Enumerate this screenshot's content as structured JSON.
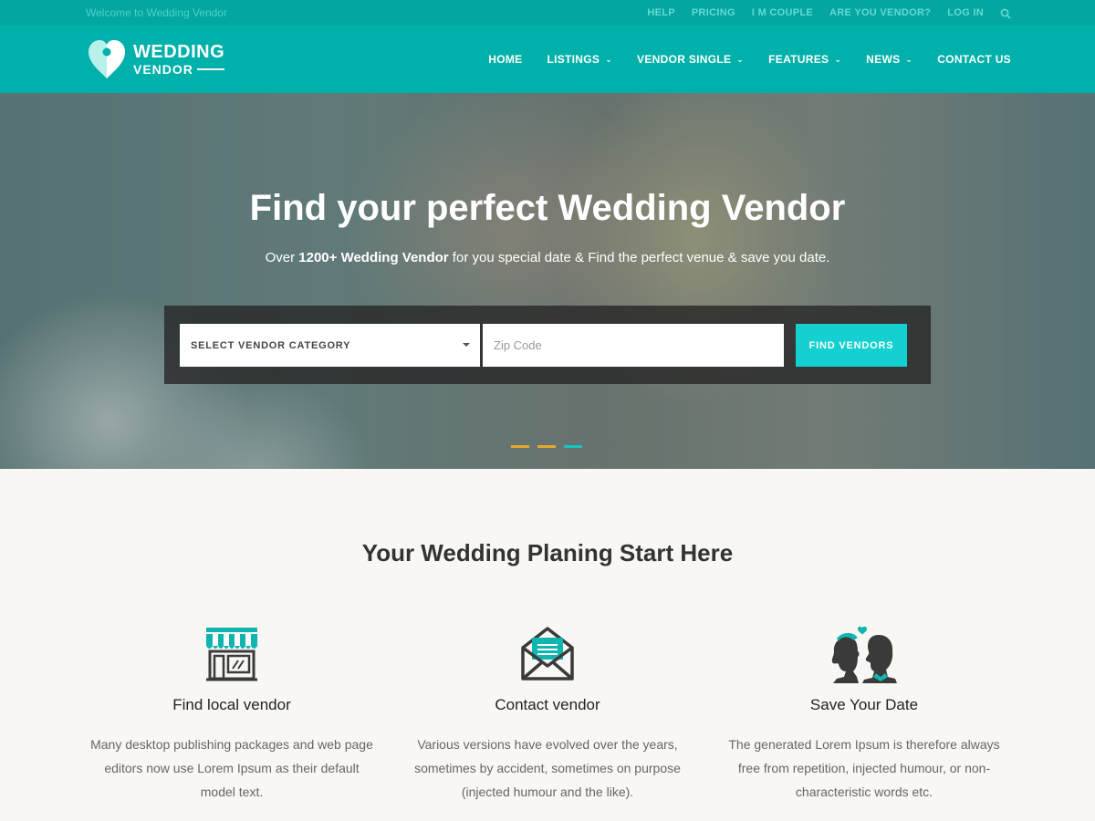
{
  "topbar": {
    "welcome": "Welcome to Wedding Vendor",
    "links": [
      "HELP",
      "PRICING",
      "I M COUPLE",
      "ARE YOU VENDOR?",
      "LOG IN"
    ],
    "search_icon": "search-icon"
  },
  "header": {
    "logo": {
      "line1": "WEDDING",
      "line2": "VENDOR",
      "icon": "heart-pin-icon"
    },
    "nav": [
      {
        "label": "HOME",
        "dropdown": false
      },
      {
        "label": "LISTINGS",
        "dropdown": true
      },
      {
        "label": "VENDOR SINGLE",
        "dropdown": true
      },
      {
        "label": "FEATURES",
        "dropdown": true
      },
      {
        "label": "NEWS",
        "dropdown": true
      },
      {
        "label": "CONTACT US",
        "dropdown": false
      }
    ]
  },
  "hero": {
    "title": "Find your perfect Wedding Vendor",
    "subtitle_pre": "Over ",
    "subtitle_bold": "1200+ Wedding Vendor",
    "subtitle_post": " for you special date & Find the perfect venue & save you date.",
    "search": {
      "category_label": "SELECT VENDOR CATEGORY",
      "zip_placeholder": "Zip Code",
      "button_label": "FIND VENDORS"
    },
    "slider_dots": [
      "#e3a92f",
      "#e3a92f",
      "#11c7c2"
    ]
  },
  "planning": {
    "title": "Your Wedding Planing Start Here",
    "features": [
      {
        "icon": "storefront-icon",
        "title": "Find local vendor",
        "text": "Many desktop publishing packages and web page editors now use Lorem Ipsum as their default model text."
      },
      {
        "icon": "envelope-icon",
        "title": "Contact vendor",
        "text": "Various versions have evolved over the years, sometimes by accident, sometimes on purpose (injected humour and the like)."
      },
      {
        "icon": "couple-icon",
        "title": "Save Your Date",
        "text": "The generated Lorem Ipsum is therefore always free from repetition, injected humour, or non-characteristic words etc."
      }
    ]
  },
  "colors": {
    "teal_dark": "#03a6a1",
    "teal": "#00b0aa",
    "button": "#14d0d0",
    "accent": "#e3a92f"
  }
}
